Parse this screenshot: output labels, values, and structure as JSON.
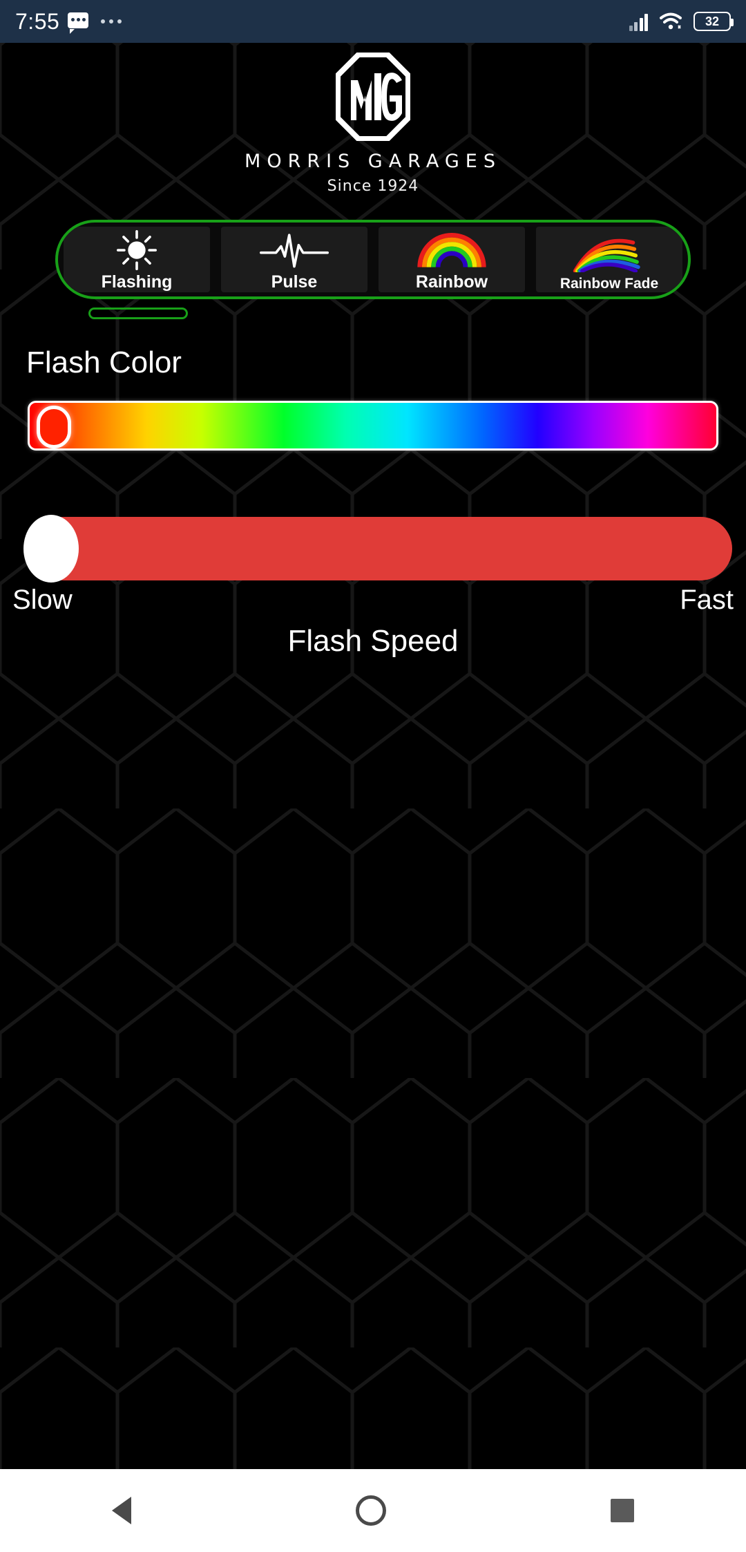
{
  "statusbar": {
    "time": "7:55",
    "message_icon": "message-icon",
    "overflow_icon": "ellipsis-icon",
    "signal_icon": "signal-bars-icon",
    "wifi_icon": "wifi-icon",
    "battery_level": "32"
  },
  "brand": {
    "logo_icon": "mg-logo-icon",
    "name": "MORRIS GARAGES",
    "since": "Since 1924"
  },
  "modes": {
    "accent_color": "#18a018",
    "tabs": [
      {
        "label": "Flashing",
        "icon": "sun-icon",
        "selected": true
      },
      {
        "label": "Pulse",
        "icon": "heartbeat-icon",
        "selected": false
      },
      {
        "label": "Rainbow",
        "icon": "rainbow-arc-icon",
        "selected": false
      },
      {
        "label": "Rainbow Fade",
        "icon": "rainbow-fade-icon",
        "selected": false
      }
    ],
    "scroll_indicator": "scroll-position-pill"
  },
  "color_section": {
    "title": "Flash Color",
    "slider_name": "hue-gradient-slider",
    "thumb_position_percent": 1,
    "thumb_color": "#ff2200"
  },
  "speed_section": {
    "title": "Flash Speed",
    "min_label": "Slow",
    "max_label": "Fast",
    "track_color": "#e03c38",
    "value_percent": 2
  },
  "navbar": {
    "back": "back-triangle-icon",
    "home": "home-circle-icon",
    "recent": "recent-apps-square-icon"
  }
}
